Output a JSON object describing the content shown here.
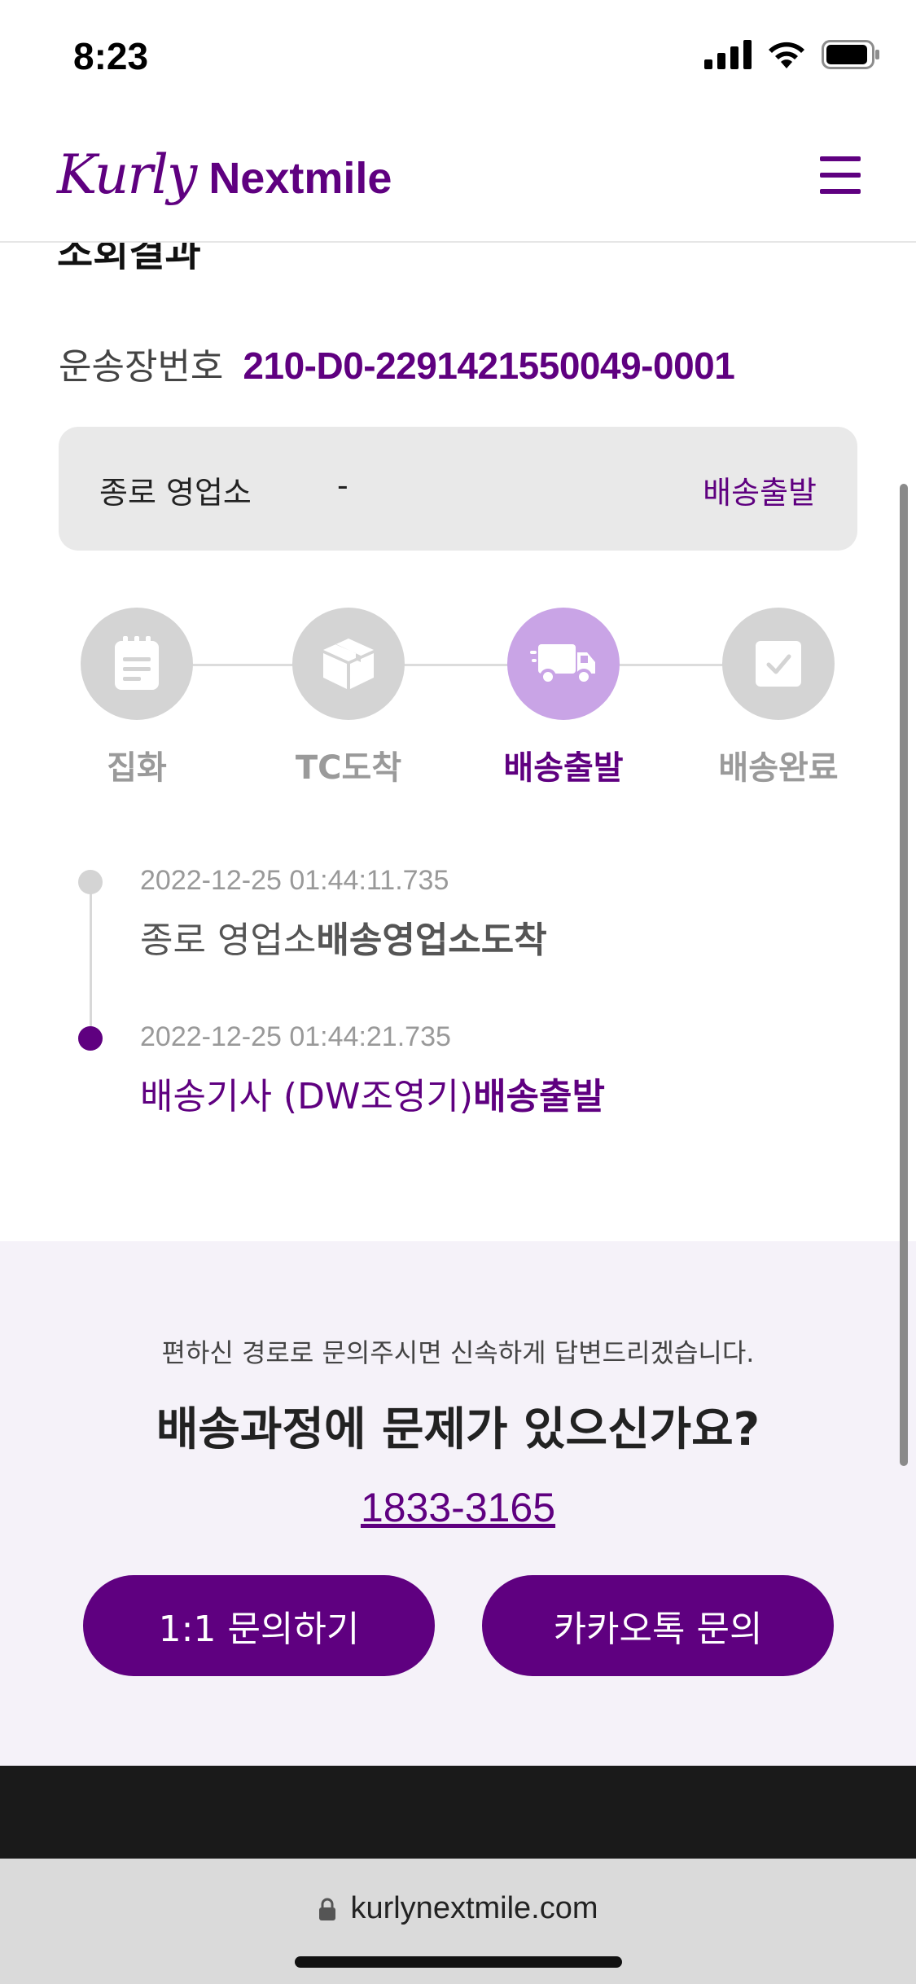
{
  "status_bar": {
    "time": "8:23"
  },
  "header": {
    "logo_script": "Kurly",
    "logo_word": "Nextmile",
    "menu_icon": "hamburger-icon"
  },
  "page": {
    "title_cut": "조회결과"
  },
  "tracking": {
    "label": "운송장번호",
    "number": "210-D0-2291421550049-0001"
  },
  "info": {
    "branch": "종로 영업소",
    "dash": "-",
    "status": "배송출발"
  },
  "steps": [
    {
      "label": "집화",
      "icon": "clipboard-icon",
      "active": false
    },
    {
      "label": "TC도착",
      "icon": "box-icon",
      "active": false
    },
    {
      "label": "배송출발",
      "icon": "truck-icon",
      "active": true
    },
    {
      "label": "배송완료",
      "icon": "check-icon",
      "active": false
    }
  ],
  "timeline": [
    {
      "time": "2022-12-25 01:44:11.735",
      "prefix": "종로 영업소",
      "event": "배송영업소도착",
      "active": false
    },
    {
      "time": "2022-12-25 01:44:21.735",
      "prefix": "배송기사 (DW조영기)",
      "event": "배송출발",
      "active": true
    }
  ],
  "contact": {
    "subtitle": "편하신 경로로 문의주시면 신속하게 답변드리겠습니다.",
    "title": "배송과정에 문제가 있으신가요?",
    "phone": "1833-3165",
    "button_inquiry": "1:1 문의하기",
    "button_kakao": "카카오톡 문의"
  },
  "browser": {
    "url": "kurlynextmile.com"
  },
  "colors": {
    "brand": "#5f0080",
    "active_step": "#c9a4e6",
    "inactive_step": "#d4d4d4"
  }
}
